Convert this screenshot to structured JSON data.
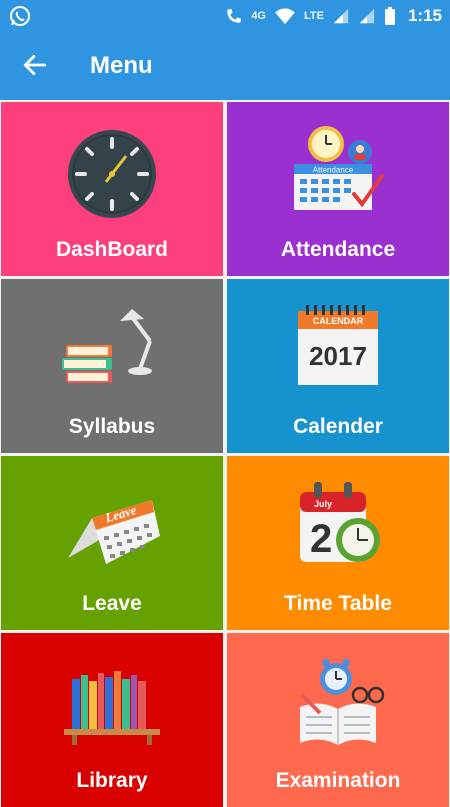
{
  "status": {
    "network": "4G",
    "lte": "LTE",
    "time": "1:15"
  },
  "header": {
    "title": "Menu"
  },
  "colors": {
    "appbar": "#2f95e0",
    "dashboard": "#fd3f7c",
    "attendance": "#9b30d1",
    "syllabus": "#707070",
    "calender": "#1693cf",
    "leave": "#65a100",
    "timetable": "#ff8c00",
    "library": "#d90000",
    "examination": "#ff6a4f"
  },
  "menu": [
    {
      "label": "DashBoard",
      "icon": "clock-icon"
    },
    {
      "label": "Attendance",
      "icon": "attendance-icon"
    },
    {
      "label": "Syllabus",
      "icon": "books-lamp-icon"
    },
    {
      "label": "Calender",
      "icon": "calendar-2017-icon",
      "icon_text_top": "CALENDAR",
      "icon_text_year": "2017"
    },
    {
      "label": "Leave",
      "icon": "leave-calendar-icon",
      "icon_text": "Leave"
    },
    {
      "label": "Time Table",
      "icon": "timetable-icon",
      "icon_text_month": "July",
      "icon_text_day": "2"
    },
    {
      "label": "Library",
      "icon": "bookshelf-icon"
    },
    {
      "label": "Examination",
      "icon": "exam-icon"
    }
  ],
  "attendance_icon_text": "Attendance"
}
